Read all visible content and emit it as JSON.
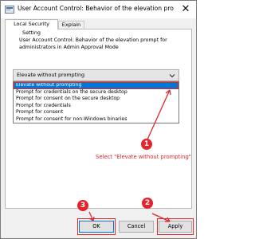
{
  "window": {
    "title": "User Account Control: Behavior of the elevation prompt f...",
    "close_glyph": "✕"
  },
  "tabs": [
    {
      "label": "Local Security Setting",
      "active": true
    },
    {
      "label": "Explain",
      "active": false
    }
  ],
  "setting": {
    "description": "User Account Control: Behavior of the elevation prompt for administrators in Admin Approval Mode"
  },
  "dropdown": {
    "value": "Elevate without prompting",
    "options": [
      "Elevate without prompting",
      "Prompt for credentials on the secure desktop",
      "Prompt for consent on the secure desktop",
      "Prompt for credentials",
      "Prompt for consent",
      "Prompt for consent for non-Windows binaries"
    ],
    "highlighted_index": 0
  },
  "annotations": {
    "step1": "1",
    "step1_text": "Select \"Elevate without prompting\"",
    "step2": "2",
    "step3": "3"
  },
  "buttons": {
    "ok": "OK",
    "cancel": "Cancel",
    "apply": "Apply"
  },
  "colors": {
    "accent": "#0078d7",
    "annotation": "#e3242b"
  },
  "icons": {
    "window": "shield-settings-icon",
    "dropdown": "chevron-down-icon"
  }
}
